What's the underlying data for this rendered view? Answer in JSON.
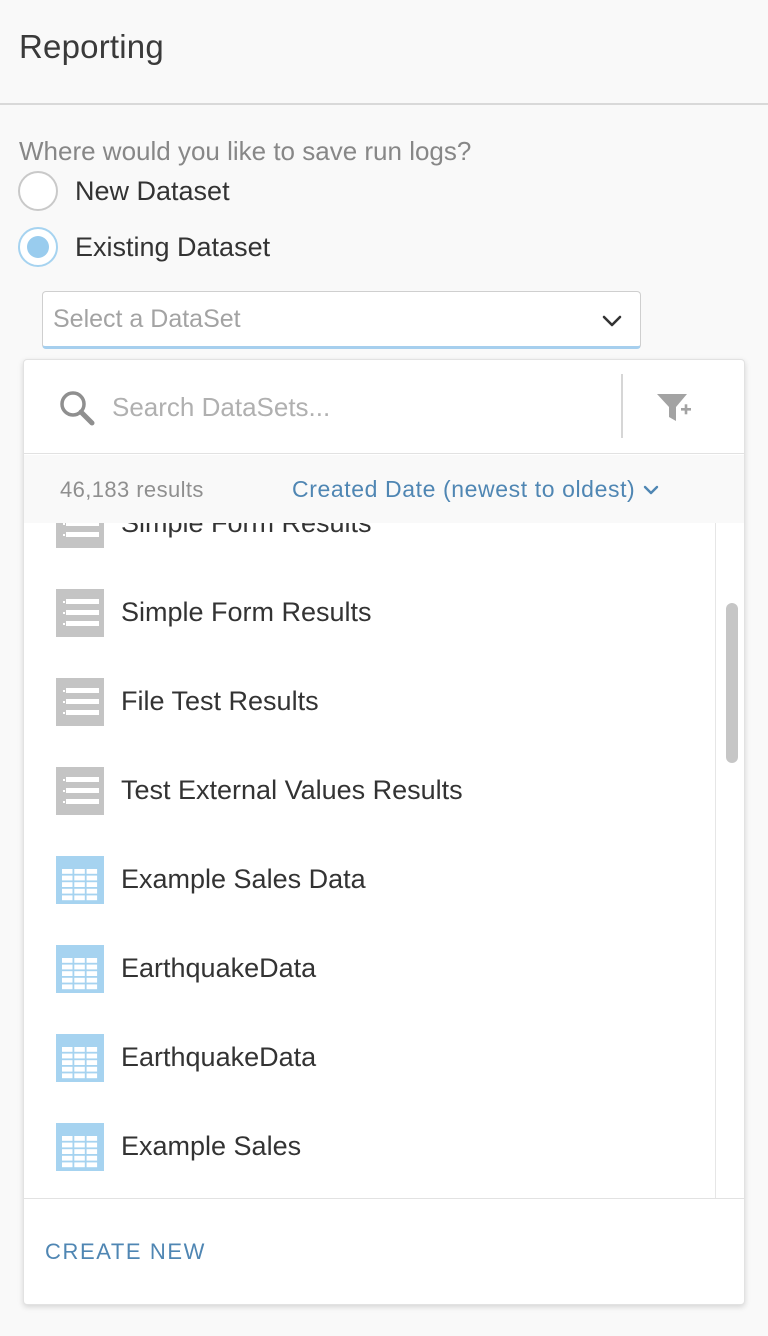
{
  "header": {
    "title": "Reporting"
  },
  "form": {
    "question": "Where would you like to save run logs?",
    "options": [
      {
        "label": "New Dataset",
        "checked": false
      },
      {
        "label": "Existing Dataset",
        "checked": true
      }
    ],
    "select": {
      "placeholder": "Select a DataSet",
      "icon": "chevron-down-icon"
    }
  },
  "dropdown": {
    "search": {
      "placeholder": "Search DataSets...",
      "value": ""
    },
    "results_count": "46,183 results",
    "sort_label": "Created Date (newest to oldest)",
    "items": [
      {
        "label": "Simple Form Results",
        "icon": "form-dataset-icon"
      },
      {
        "label": "Simple Form Results",
        "icon": "form-dataset-icon"
      },
      {
        "label": "File Test Results",
        "icon": "form-dataset-icon"
      },
      {
        "label": "Test External Values Results",
        "icon": "form-dataset-icon"
      },
      {
        "label": "Example Sales Data",
        "icon": "table-dataset-icon"
      },
      {
        "label": "EarthquakeData",
        "icon": "table-dataset-icon"
      },
      {
        "label": "EarthquakeData",
        "icon": "table-dataset-icon"
      },
      {
        "label": "Example Sales",
        "icon": "table-dataset-icon"
      }
    ],
    "create_new": "CREATE NEW"
  },
  "colors": {
    "accent": "#4f86b3",
    "radio_selected": "#99ccee",
    "table_icon": "#a6d3f0",
    "form_icon": "#c4c4c4"
  }
}
